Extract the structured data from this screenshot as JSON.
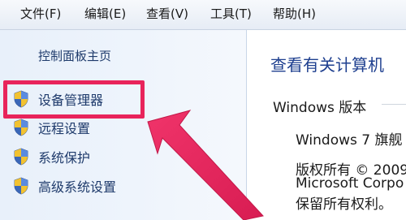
{
  "menubar": {
    "items": [
      {
        "label": "文件(F)"
      },
      {
        "label": "编辑(E)"
      },
      {
        "label": "查看(V)"
      },
      {
        "label": "工具(T)"
      },
      {
        "label": "帮助(H)"
      }
    ]
  },
  "sidebar": {
    "home_link": "控制面板主页",
    "items": [
      {
        "label": "设备管理器",
        "icon": "uac-shield-icon"
      },
      {
        "label": "远程设置",
        "icon": "uac-shield-icon"
      },
      {
        "label": "系统保护",
        "icon": "uac-shield-icon"
      },
      {
        "label": "高级系统设置",
        "icon": "uac-shield-icon"
      }
    ]
  },
  "content": {
    "title": "查看有关计算机",
    "section_heading": "Windows 版本",
    "lines": [
      "Windows 7 旗舰",
      "版权所有 © 2009",
      "Microsoft Corpo",
      "保留所有权利。"
    ]
  },
  "annotation": {
    "highlight_color": "#e8245b",
    "arrow_color": "#e8245b"
  }
}
